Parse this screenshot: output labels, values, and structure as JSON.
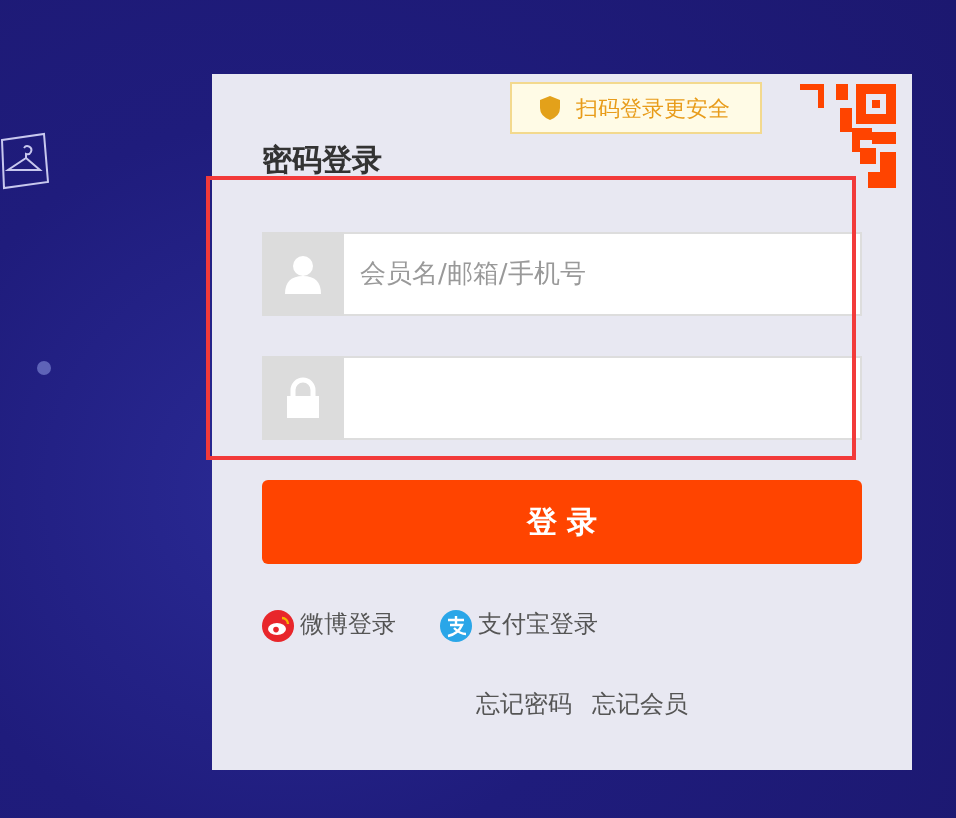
{
  "tooltip": {
    "text": "扫码登录更安全"
  },
  "title": "密码登录",
  "fields": [
    {
      "kind": "user",
      "placeholder": "会员名/邮箱/手机号"
    },
    {
      "kind": "password"
    }
  ],
  "login_button": "登 录",
  "social": [
    {
      "kind": "weibo",
      "label": "微博登录"
    },
    {
      "kind": "alipay",
      "label": "支付宝登录"
    }
  ],
  "links": [
    "忘记密码",
    "忘记会员"
  ]
}
